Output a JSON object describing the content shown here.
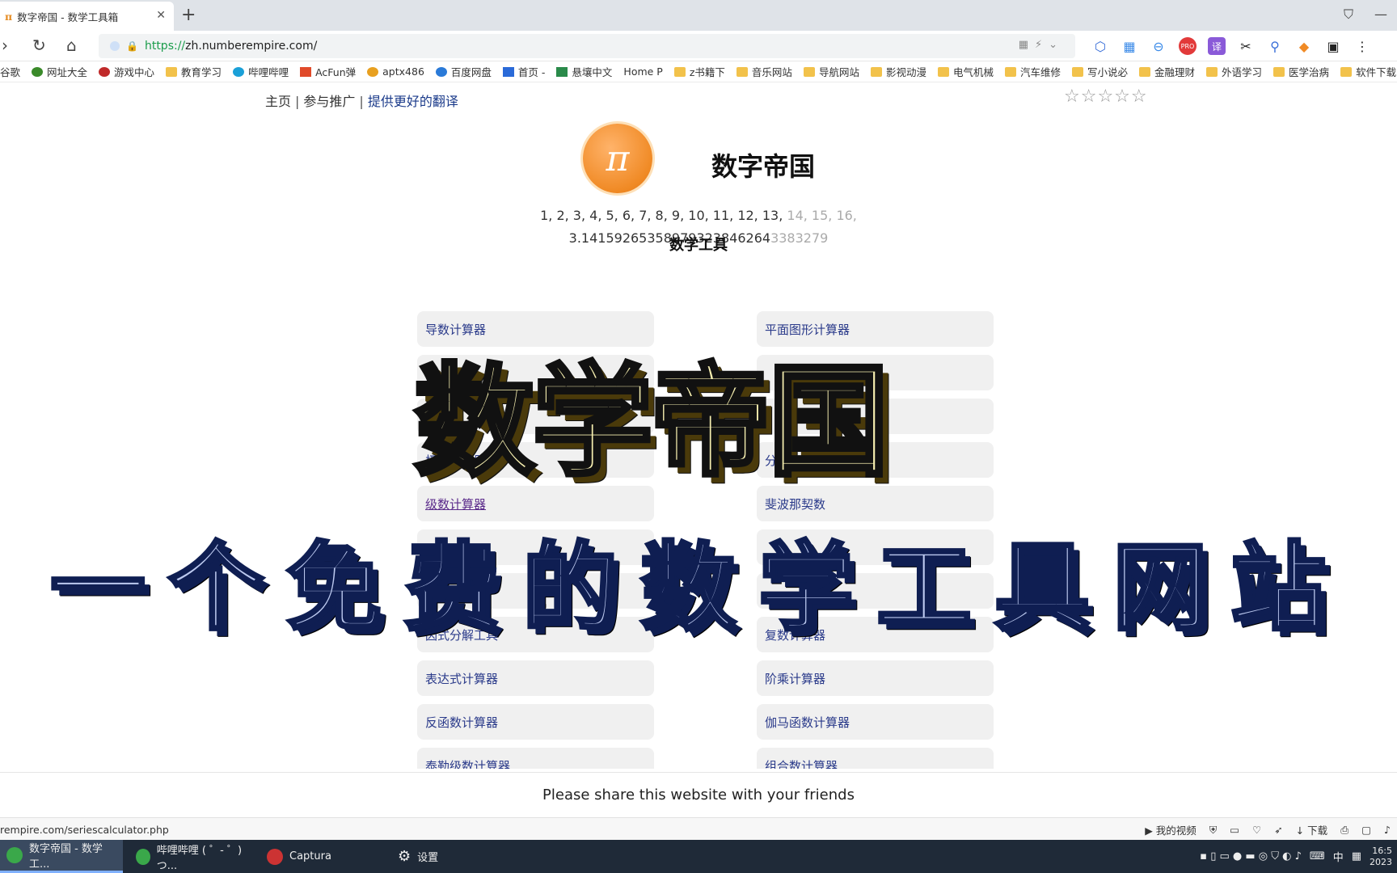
{
  "browser": {
    "tab_title": "数字帝国 - 数学工具箱",
    "tab_icon_glyph": "π",
    "url_scheme": "https://",
    "url_host": "zh.numberempire.com/",
    "bookmarks": [
      "谷歌",
      "网址大全",
      "游戏中心",
      "教育学习",
      "哔哩哔哩",
      "AcFun弹",
      "aptx486",
      "百度网盘",
      "首页 -",
      "悬壤中文",
      "Home P",
      "z书籍下",
      "音乐网站",
      "导航网站",
      "影视动漫",
      "电气机械",
      "汽车维修",
      "写小说必",
      "金融理财",
      "外语学习",
      "医学治病",
      "软件下载"
    ]
  },
  "page": {
    "nav": {
      "home": "主页",
      "promote": "参与推广",
      "translate": "提供更好的翻译",
      "separator": "|"
    },
    "stars": "☆☆☆☆☆",
    "logo_glyph": "π",
    "site_title": "数字帝国",
    "sequence_visible": "1, 2, 3, 4, 5, 6, 7, 8, 9, 10, 11, 12, 13,",
    "sequence_faded": " 14, 15, 16,",
    "pi_visible": "3.14159265358979323846264",
    "pi_faded": "3383279",
    "tools_heading": "数学工具",
    "tools_left": [
      "导数计算器",
      "",
      "",
      "极限计算器",
      "级数计算器",
      "",
      "",
      "因式分解工具",
      "表达式计算器",
      "反函数计算器",
      "泰勒级数计算器"
    ],
    "tools_right": [
      "平面图形计算器",
      "",
      "",
      "分解素因数工具",
      "斐波那契数",
      "",
      "",
      "复数计算器",
      "阶乘计算器",
      "伽马函数计算器",
      "组合数计算器"
    ],
    "overlay_title": "数学帝国",
    "overlay_subtitle": "一个免费的数学工具网站",
    "share_text": "Please share this website with your friends"
  },
  "status": {
    "hover_url": "rempire.com/seriescalculator.php",
    "my_video": "我的视频",
    "download": "下载"
  },
  "taskbar": {
    "tasks": [
      "数字帝国 - 数学工...",
      "哔哩哔哩 ( ゜- ゜)つ...",
      "Captura",
      "设置"
    ],
    "ime": "中",
    "time": "16:5",
    "year": "2023"
  },
  "colors": {
    "orange": "#f08a25",
    "link": "#2a3a8a",
    "visited": "#5a2a8a",
    "overlay1_fill": "#f6efb0",
    "overlay2_fill": "#bcc9ef"
  }
}
